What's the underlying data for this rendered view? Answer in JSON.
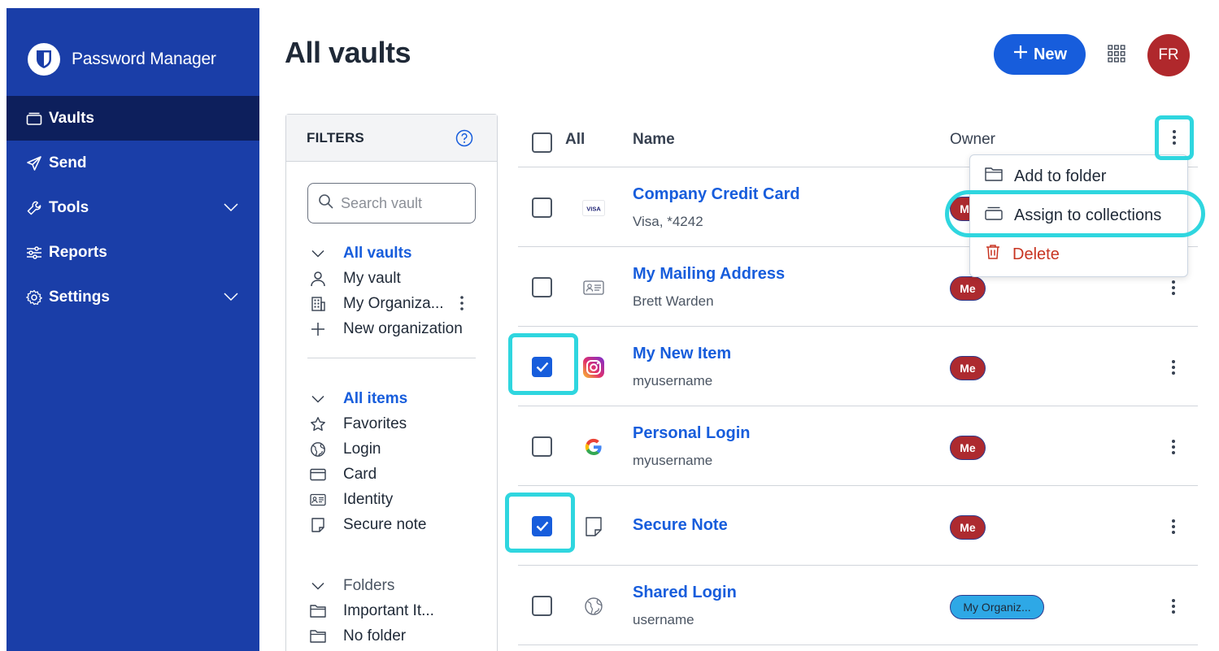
{
  "app": {
    "brand": "Password Manager",
    "colors": {
      "sidebar": "#1a3ea8",
      "sidebar_active": "#0d1f5c",
      "accent": "#175ddc",
      "owner_badge": "#ad2a2f",
      "org_badge": "#2ea8e6",
      "highlight": "#2fd6df",
      "danger": "#c83522"
    }
  },
  "sidebar": {
    "items": [
      {
        "label": "Vaults",
        "icon": "vault-icon",
        "active": true
      },
      {
        "label": "Send",
        "icon": "send-icon"
      },
      {
        "label": "Tools",
        "icon": "wrench-icon",
        "expandable": true
      },
      {
        "label": "Reports",
        "icon": "sliders-icon"
      },
      {
        "label": "Settings",
        "icon": "gear-icon",
        "expandable": true
      }
    ]
  },
  "header": {
    "title": "All vaults",
    "new_label": "New",
    "avatar_initials": "FR"
  },
  "filters": {
    "title": "FILTERS",
    "search_placeholder": "Search vault",
    "vaults": {
      "header": "All vaults",
      "items": [
        {
          "label": "My vault",
          "icon": "person-icon"
        },
        {
          "label": "My Organiza...",
          "icon": "building-icon"
        },
        {
          "label": "New organization",
          "icon": "plus-icon"
        }
      ]
    },
    "types": {
      "header": "All items",
      "items": [
        {
          "label": "Favorites",
          "icon": "star-icon"
        },
        {
          "label": "Login",
          "icon": "globe-icon"
        },
        {
          "label": "Card",
          "icon": "card-icon"
        },
        {
          "label": "Identity",
          "icon": "id-card-icon"
        },
        {
          "label": "Secure note",
          "icon": "note-icon"
        }
      ]
    },
    "folders": {
      "header": "Folders",
      "items": [
        {
          "label": "Important It...",
          "icon": "folder-icon"
        },
        {
          "label": "No folder",
          "icon": "folder-icon"
        }
      ]
    }
  },
  "table": {
    "columns": {
      "all": "All",
      "name": "Name",
      "owner": "Owner"
    },
    "rows": [
      {
        "name": "Company Credit Card",
        "sub": "Visa, *4242",
        "owner": "Me",
        "checked": false,
        "icon": "visa-icon"
      },
      {
        "name": "My Mailing Address",
        "sub": "Brett Warden",
        "owner": "Me",
        "checked": false,
        "icon": "id-card-icon"
      },
      {
        "name": "My New Item",
        "sub": "myusername",
        "owner": "Me",
        "checked": true,
        "icon": "instagram-icon"
      },
      {
        "name": "Personal Login",
        "sub": "myusername",
        "owner": "Me",
        "checked": false,
        "icon": "google-icon"
      },
      {
        "name": "Secure Note",
        "sub": "",
        "owner": "Me",
        "checked": true,
        "icon": "note-icon"
      },
      {
        "name": "Shared Login",
        "sub": "username",
        "owner": "My Organiz...",
        "checked": false,
        "icon": "globe-icon"
      }
    ]
  },
  "bulk_menu": {
    "items": [
      {
        "label": "Add to folder",
        "icon": "folder-icon"
      },
      {
        "label": "Assign to collections",
        "icon": "collection-icon"
      },
      {
        "label": "Delete",
        "icon": "trash-icon"
      }
    ]
  }
}
